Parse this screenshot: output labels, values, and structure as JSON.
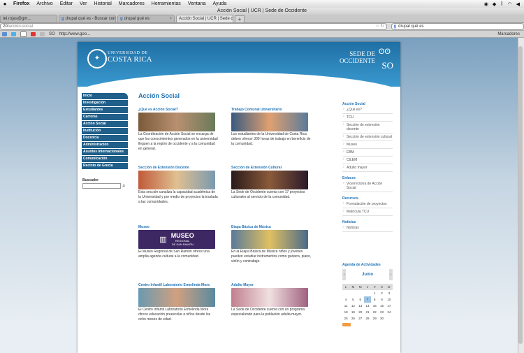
{
  "menubar": {
    "items": [
      "Firefox",
      "Archivo",
      "Editar",
      "Ver",
      "Historial",
      "Marcadores",
      "Herramientas",
      "Ventana",
      "Ayuda"
    ]
  },
  "window": {
    "title": "Acción Social | UCR | Sede de Occidente"
  },
  "tabs": [
    {
      "label": "tel.rojas@gm..."
    },
    {
      "label": "drupal qué es - Buscar con Goo..."
    },
    {
      "label": "drupal qué es"
    },
    {
      "label": "Acción Social | UCR | Sede de O..."
    }
  ],
  "nav": {
    "url_host": "20/",
    "url_path": "acción-social",
    "search_value": "drupal qué es"
  },
  "bookmarks": {
    "items": [
      "SO",
      "http://www.goo..."
    ],
    "right_label": "Marcadores"
  },
  "site": {
    "logo_line1": "UNIVERSIDAD DE",
    "logo_line2": "COSTA RICA",
    "sede_line1": "SEDE DE",
    "sede_line2": "OCCIDENTE",
    "sede_abbr": "SO",
    "left_nav": [
      "Inicio",
      "Investigación",
      "Estudiantes",
      "Carreras",
      "Acción Social",
      "Institución",
      "Docencia",
      "Administración",
      "Asuntos Internacionales",
      "Comunicación",
      "Recinto de Grecia"
    ],
    "search_label": "Buscador",
    "page_title": "Acción Social",
    "cards": [
      {
        "title": "¿Qué es Acción Social?",
        "text": "La Coordinación de Acción Social se encarga de que los conocimientos generados en la universidad lleguen a la región de occidente y a la comunidad en general.",
        "color": "#8a6a4a"
      },
      {
        "title": "Trabajo Comunal Universitario",
        "text": "Los estudiantes de la Universidad de Costa Rica deben ofrecer 300 horas de trabajo en beneficio de la comunidad.",
        "color": "#5a7aa0"
      },
      {
        "title": "Sección de Extensión Docente",
        "text": "Esta sección canaliza la capacidad académica de la Universidad y por medio de proyectos la traslada a las comunidades.",
        "color": "#c08a5a"
      },
      {
        "title": "Sección de Extensión Cultural",
        "text": "La Sede de Occidente cuenta con 17 proyectos culturales al servicio de la comunidad.",
        "color": "#4a3a3a"
      },
      {
        "title": "Museo",
        "text": "El Museo Regional de San Ramón ofrece una amplia agenda cultural a la comunidad.",
        "color": "#4a2a6a",
        "img_text1": "MUSEO",
        "img_text2": "REGIONAL",
        "img_text3": "DE SAN RAMÓN"
      },
      {
        "title": "Etapa Básica de Música",
        "text": "En la Etapa Básica de Música niños y jóvenes pueden estudiar instrumentos como guitarra, piano, violín y contrabajo.",
        "color": "#6a8aa0"
      },
      {
        "title": "Centro Infantil Laboratorio Ermelinda Mora",
        "text": "El Centro Infantil Laboratorio Ermelinda Mora ofrece educación preescolar a niños desde los ocho meses de edad.",
        "color": "#7a9aaa"
      },
      {
        "title": "Adulto Mayor",
        "text": "La Sede de Occidente cuenta con un programa especializado para la población adulta mayor.",
        "color": "#b07a8a"
      }
    ],
    "sidebar": {
      "accion_title": "Acción Social",
      "accion_items": [
        "¿Qué es?",
        "TCU",
        "Sección de extensión docente",
        "Sección de extensión cultural",
        "Museo",
        "EBM",
        "CILEM",
        "Adulto mayor"
      ],
      "enlaces_title": "Enlaces",
      "enlaces_items": [
        "Vicerrectoría de Acción Social"
      ],
      "recursos_title": "Recursos",
      "recursos_items": [
        "Formulación de proyectos",
        "Matrícula TCU"
      ],
      "noticias_title": "Noticias",
      "noticias_items": [
        "Noticias"
      ],
      "agenda_title": "Agenda de Actividades",
      "month": "Junio",
      "weekdays": [
        "L",
        "M",
        "M",
        "J",
        "V",
        "S",
        "D"
      ],
      "weeks": [
        [
          "",
          "",
          "",
          "",
          "1",
          "2",
          "3"
        ],
        [
          "4",
          "5",
          "6",
          "7",
          "8",
          "9",
          "10"
        ],
        [
          "11",
          "12",
          "13",
          "14",
          "15",
          "16",
          "17"
        ],
        [
          "18",
          "19",
          "20",
          "21",
          "22",
          "23",
          "24"
        ],
        [
          "25",
          "26",
          "27",
          "28",
          "29",
          "30",
          ""
        ]
      ],
      "today": "7"
    }
  }
}
